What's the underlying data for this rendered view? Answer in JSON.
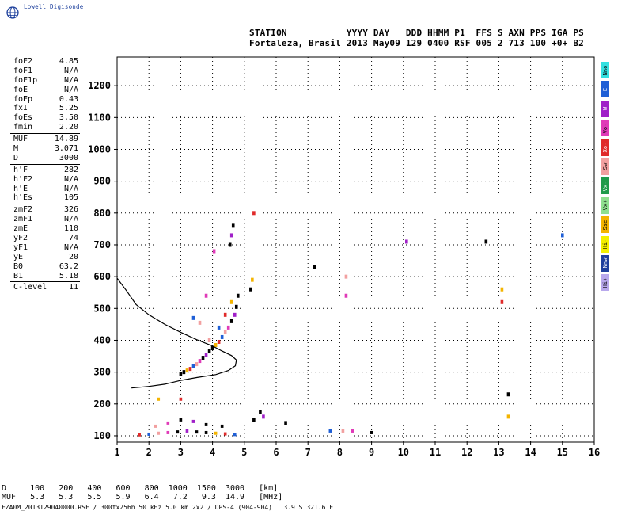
{
  "logo": {
    "text": "Lowell Digisonde",
    "icon": "globe-icon"
  },
  "header": {
    "line1": "STATION           YYYY DAY   DDD HHMM P1  FFS S AXN PPS IGA PS",
    "line2": "Fortaleza, Brasil 2013 May09 129 0400 RSF 005 2 713 100 +0+ B2"
  },
  "params": {
    "group1": [
      {
        "label": "foF2",
        "value": "4.85"
      },
      {
        "label": "foF1",
        "value": "N/A"
      },
      {
        "label": "foF1p",
        "value": "N/A"
      },
      {
        "label": "foE",
        "value": "N/A"
      },
      {
        "label": "foEp",
        "value": "0.43"
      },
      {
        "label": "fxI",
        "value": "5.25"
      },
      {
        "label": "foEs",
        "value": "3.50"
      },
      {
        "label": "fmin",
        "value": "2.20"
      }
    ],
    "group2": [
      {
        "label": "MUF",
        "value": "14.89"
      },
      {
        "label": "M",
        "value": "3.071"
      },
      {
        "label": "D",
        "value": "3000"
      }
    ],
    "group3": [
      {
        "label": "h'F",
        "value": "282"
      },
      {
        "label": "h'F2",
        "value": "N/A"
      },
      {
        "label": "h'E",
        "value": "N/A"
      },
      {
        "label": "h'Es",
        "value": "105"
      }
    ],
    "group4": [
      {
        "label": "zmF2",
        "value": "326"
      },
      {
        "label": "zmF1",
        "value": "N/A"
      },
      {
        "label": "zmE",
        "value": "110"
      },
      {
        "label": "yF2",
        "value": "74"
      },
      {
        "label": "yF1",
        "value": "N/A"
      },
      {
        "label": "yE",
        "value": "20"
      },
      {
        "label": "B0",
        "value": "63.2"
      },
      {
        "label": "B1",
        "value": "5.18"
      }
    ],
    "group5": [
      {
        "label": "C-level",
        "value": "11"
      }
    ]
  },
  "legend": [
    {
      "label": "Nno",
      "color": "#33e0e0"
    },
    {
      "label": "E",
      "color": "#1f5fd6"
    },
    {
      "label": "W",
      "color": "#a020c8"
    },
    {
      "label": "Vo-",
      "color": "#e03ab8"
    },
    {
      "label": "Xo-",
      "color": "#e02a2a"
    },
    {
      "label": "Sw",
      "color": "#f2a0a0"
    },
    {
      "label": "Vx-",
      "color": "#1f9a4a"
    },
    {
      "label": "Vx+",
      "color": "#8fe08f"
    },
    {
      "label": "Sse",
      "color": "#f4b400"
    },
    {
      "label": "Hi-",
      "color": "#f4f000"
    },
    {
      "label": "Nnw",
      "color": "#1f3f9c"
    },
    {
      "label": "Hi+",
      "color": "#b8a8ec"
    }
  ],
  "chart_data": {
    "type": "scatter",
    "xlim": [
      1,
      16
    ],
    "ylim": [
      80,
      1290
    ],
    "xticks": [
      "1",
      "2",
      "3",
      "4",
      "5",
      "6",
      "7",
      "8",
      "9",
      "10",
      "11",
      "12",
      "13",
      "14",
      "15",
      "16"
    ],
    "yticks": [
      "100",
      "200",
      "300",
      "400",
      "500",
      "600",
      "700",
      "800",
      "900",
      "1000",
      "1100",
      "1200"
    ],
    "grid": "dotted",
    "profile_curve": [
      [
        1.0,
        595
      ],
      [
        1.3,
        555
      ],
      [
        1.6,
        512
      ],
      [
        2.0,
        480
      ],
      [
        2.5,
        450
      ],
      [
        3.0,
        425
      ],
      [
        3.5,
        402
      ],
      [
        4.0,
        382
      ],
      [
        4.3,
        366
      ],
      [
        4.6,
        352
      ],
      [
        4.75,
        338
      ],
      [
        4.72,
        320
      ],
      [
        4.5,
        305
      ],
      [
        4.1,
        292
      ],
      [
        3.5,
        283
      ],
      [
        3.0,
        274
      ],
      [
        2.5,
        262
      ],
      [
        2.0,
        255
      ],
      [
        1.45,
        250
      ]
    ],
    "f_trace_points": [
      [
        3.0,
        295
      ],
      [
        3.1,
        300
      ],
      [
        3.2,
        305
      ],
      [
        3.3,
        310
      ],
      [
        3.4,
        318
      ],
      [
        3.5,
        325
      ],
      [
        3.6,
        335
      ],
      [
        3.7,
        345
      ],
      [
        3.8,
        355
      ],
      [
        3.9,
        365
      ],
      [
        4.0,
        375
      ],
      [
        4.1,
        385
      ],
      [
        4.2,
        395
      ],
      [
        4.3,
        410
      ],
      [
        4.4,
        425
      ],
      [
        4.5,
        440
      ],
      [
        4.6,
        460
      ],
      [
        4.7,
        480
      ],
      [
        4.75,
        505
      ],
      [
        4.8,
        540
      ],
      [
        4.6,
        520
      ],
      [
        4.4,
        480
      ],
      [
        4.2,
        440
      ],
      [
        3.9,
        400
      ],
      [
        4.05,
        680
      ],
      [
        4.55,
        700
      ],
      [
        4.6,
        730
      ],
      [
        4.65,
        760
      ],
      [
        5.2,
        560
      ],
      [
        5.25,
        590
      ],
      [
        5.3,
        800
      ],
      [
        3.4,
        470
      ],
      [
        3.6,
        455
      ],
      [
        3.8,
        540
      ],
      [
        5.5,
        175
      ],
      [
        5.6,
        160
      ],
      [
        5.3,
        150
      ],
      [
        6.3,
        140
      ],
      [
        13.1,
        560
      ],
      [
        13.1,
        520
      ],
      [
        15.0,
        730
      ],
      [
        8.2,
        600
      ],
      [
        8.2,
        540
      ],
      [
        7.2,
        630
      ],
      [
        10.1,
        710
      ],
      [
        12.6,
        710
      ],
      [
        13.3,
        230
      ],
      [
        13.3,
        160
      ]
    ],
    "e_trace_points": [
      [
        1.7,
        103
      ],
      [
        2.0,
        105
      ],
      [
        2.3,
        108
      ],
      [
        2.6,
        110
      ],
      [
        2.9,
        112
      ],
      [
        3.2,
        115
      ],
      [
        3.5,
        112
      ],
      [
        3.8,
        110
      ],
      [
        4.1,
        108
      ],
      [
        4.4,
        106
      ],
      [
        4.7,
        104
      ],
      [
        2.2,
        130
      ],
      [
        2.6,
        140
      ],
      [
        3.0,
        150
      ],
      [
        3.4,
        145
      ],
      [
        3.8,
        135
      ],
      [
        4.3,
        130
      ],
      [
        2.3,
        215
      ],
      [
        3.0,
        215
      ],
      [
        7.7,
        115
      ],
      [
        8.1,
        115
      ],
      [
        8.4,
        115
      ],
      [
        9.0,
        110
      ]
    ],
    "table": {
      "row1": "D     100   200   400   600   800  1000  1500  3000   [km]",
      "row2": "MUF   5.3   5.3   5.5   5.9   6.4   7.2   9.3  14.9   [MHz]"
    },
    "footer": "FZA0M_2013129040000.RSF / 300fx256h 50 kHz 5.0 km 2x2 / DPS-4 (904-904)   3.9 S 321.6 E"
  }
}
